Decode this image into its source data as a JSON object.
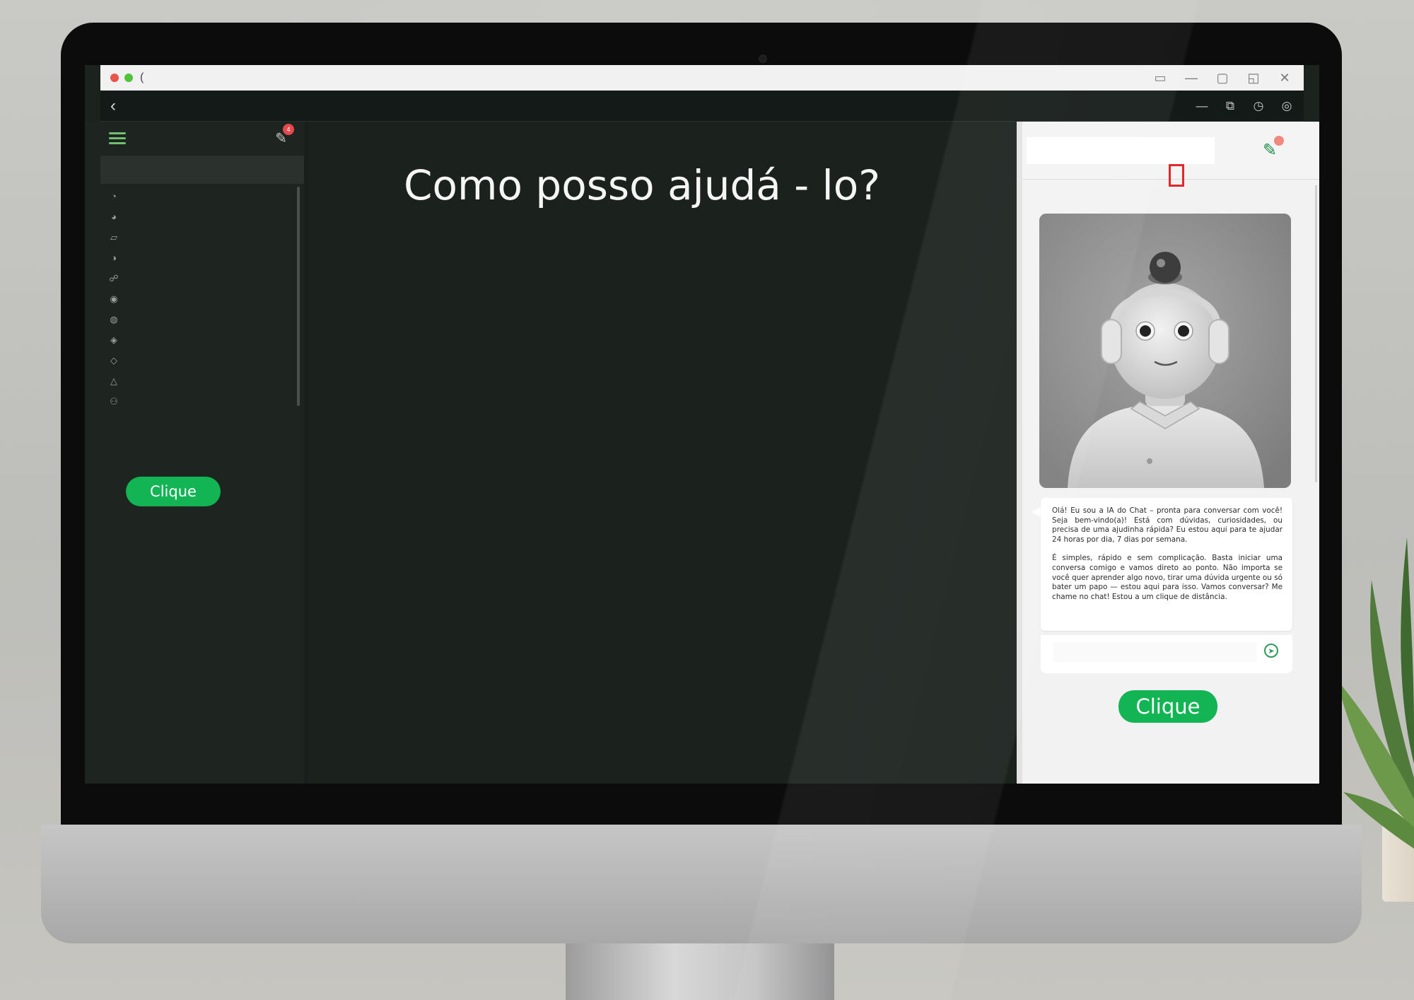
{
  "window": {
    "tab_glyph": "(",
    "controls": [
      "▭",
      "—",
      "▢",
      "◱",
      "✕"
    ]
  },
  "nav": {
    "back_glyph": "‹",
    "tools": [
      "—",
      "⧉",
      "◷",
      "◎"
    ]
  },
  "sidebar": {
    "new_chat_glyph": "✎",
    "badge": "4",
    "icons": [
      "◔",
      "◕",
      "▱",
      "◑",
      "☍",
      "◉",
      "◍",
      "◈",
      "◇",
      "△",
      "⚇"
    ],
    "button_label": "Clique"
  },
  "main": {
    "headline": "Como posso ajudá - lo?"
  },
  "panel": {
    "edit_glyph": "✎",
    "edit_badge": "",
    "message_paragraphs": [
      "Olá! Eu sou a IA do Chat – pronta para conversar com você! Seja bem-vindo(a)! Está com dúvidas, curiosidades, ou precisa de uma ajudinha rápida? Eu estou aqui para te ajudar 24 horas por dia, 7 dias por semana.",
      "É simples, rápido e sem complicação. Basta iniciar uma conversa comigo e vamos direto ao ponto. Não importa se você quer aprender algo novo, tirar uma dúvida urgente ou só bater um papo — estou aqui para isso. Vamos conversar? Me chame no chat! Estou a um clique de distância."
    ],
    "input_placeholder": "",
    "send_glyph": "➤",
    "button_label": "Clique"
  },
  "colors": {
    "accent_green": "#12b453",
    "marker_red": "#e02a2a"
  }
}
